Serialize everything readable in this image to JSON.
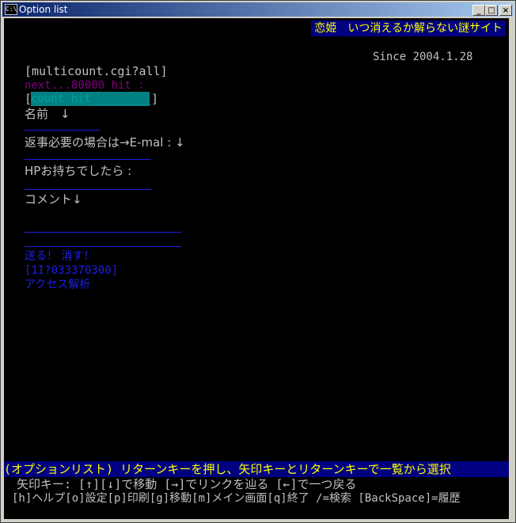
{
  "window": {
    "title": "Option list",
    "icon_label": "C:\\",
    "buttons": {
      "minimize": "_",
      "maximize": "□",
      "close": "×"
    }
  },
  "page": {
    "banner": "恋姫　いつ消えるか解らない謎サイト",
    "since": "Since 2004.1.28",
    "counter_link": "[multicount.cgi?all]",
    "next_hit": "next...80000 hit :",
    "count_field_open": "[",
    "count_field_value": "count hit_________",
    "count_field_close": "]",
    "name_label": "名前　↓",
    "email_label": "返事必要の場合は→E-mal : ↓",
    "hp_label": "HPお持ちでしたら :",
    "comment_label": "コメント↓",
    "submit_links": "送る！ 消す！",
    "id_link": "[1I?033370300]",
    "access_link": "アクセス解析"
  },
  "status": {
    "line1": "(オプションリスト) リターンキーを押し、矢印キーとリターンキーで一覧から選択",
    "line2": "矢印キー: [↑][↓]で移動 [→]でリンクを辿る [←]で一つ戻る",
    "line3": "[h]ヘルプ[o]設定[p]印刷[g]移動[m]メイン画面[q]終了 /=検索 [BackSpace]=履歴"
  },
  "colors": {
    "title_bar": "#0a246a",
    "banner_bg": "#000080",
    "banner_fg": "#ffff00",
    "link_blue": "#1e1ee6",
    "purple": "#800080",
    "teal": "#008080"
  }
}
